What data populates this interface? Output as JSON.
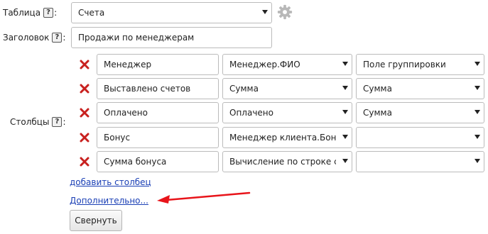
{
  "table": {
    "label": "Таблица",
    "help": "?",
    "value": "Счета"
  },
  "title": {
    "label": "Заголовок",
    "help": "?",
    "value": "Продажи по менеджерам"
  },
  "columns": {
    "label": "Столбцы",
    "help": "?",
    "rows": [
      {
        "name": "Менеджер",
        "field": "Менеджер.ФИО",
        "aggregate": "Поле группировки"
      },
      {
        "name": "Выставлено счетов",
        "field": "Сумма",
        "aggregate": "Сумма"
      },
      {
        "name": "Оплачено",
        "field": "Оплачено",
        "aggregate": "Сумма"
      },
      {
        "name": "Бонус",
        "field": "Менеджер клиента.Бон",
        "aggregate": ""
      },
      {
        "name": "Сумма бонуса",
        "field": "Вычисление по строке с",
        "aggregate": ""
      }
    ]
  },
  "links": {
    "add_column": "добавить столбец",
    "more": "Дополнительно..."
  },
  "buttons": {
    "collapse": "Свернуть"
  },
  "colors": {
    "delete": "#c8201e",
    "arrow": "#e8141a",
    "link": "#1a3fb5",
    "gear": "#b8b8b8"
  },
  "icons": {
    "delete": "delete-x-icon",
    "settings": "gear-icon",
    "dropdown": "chevron-down-icon"
  }
}
